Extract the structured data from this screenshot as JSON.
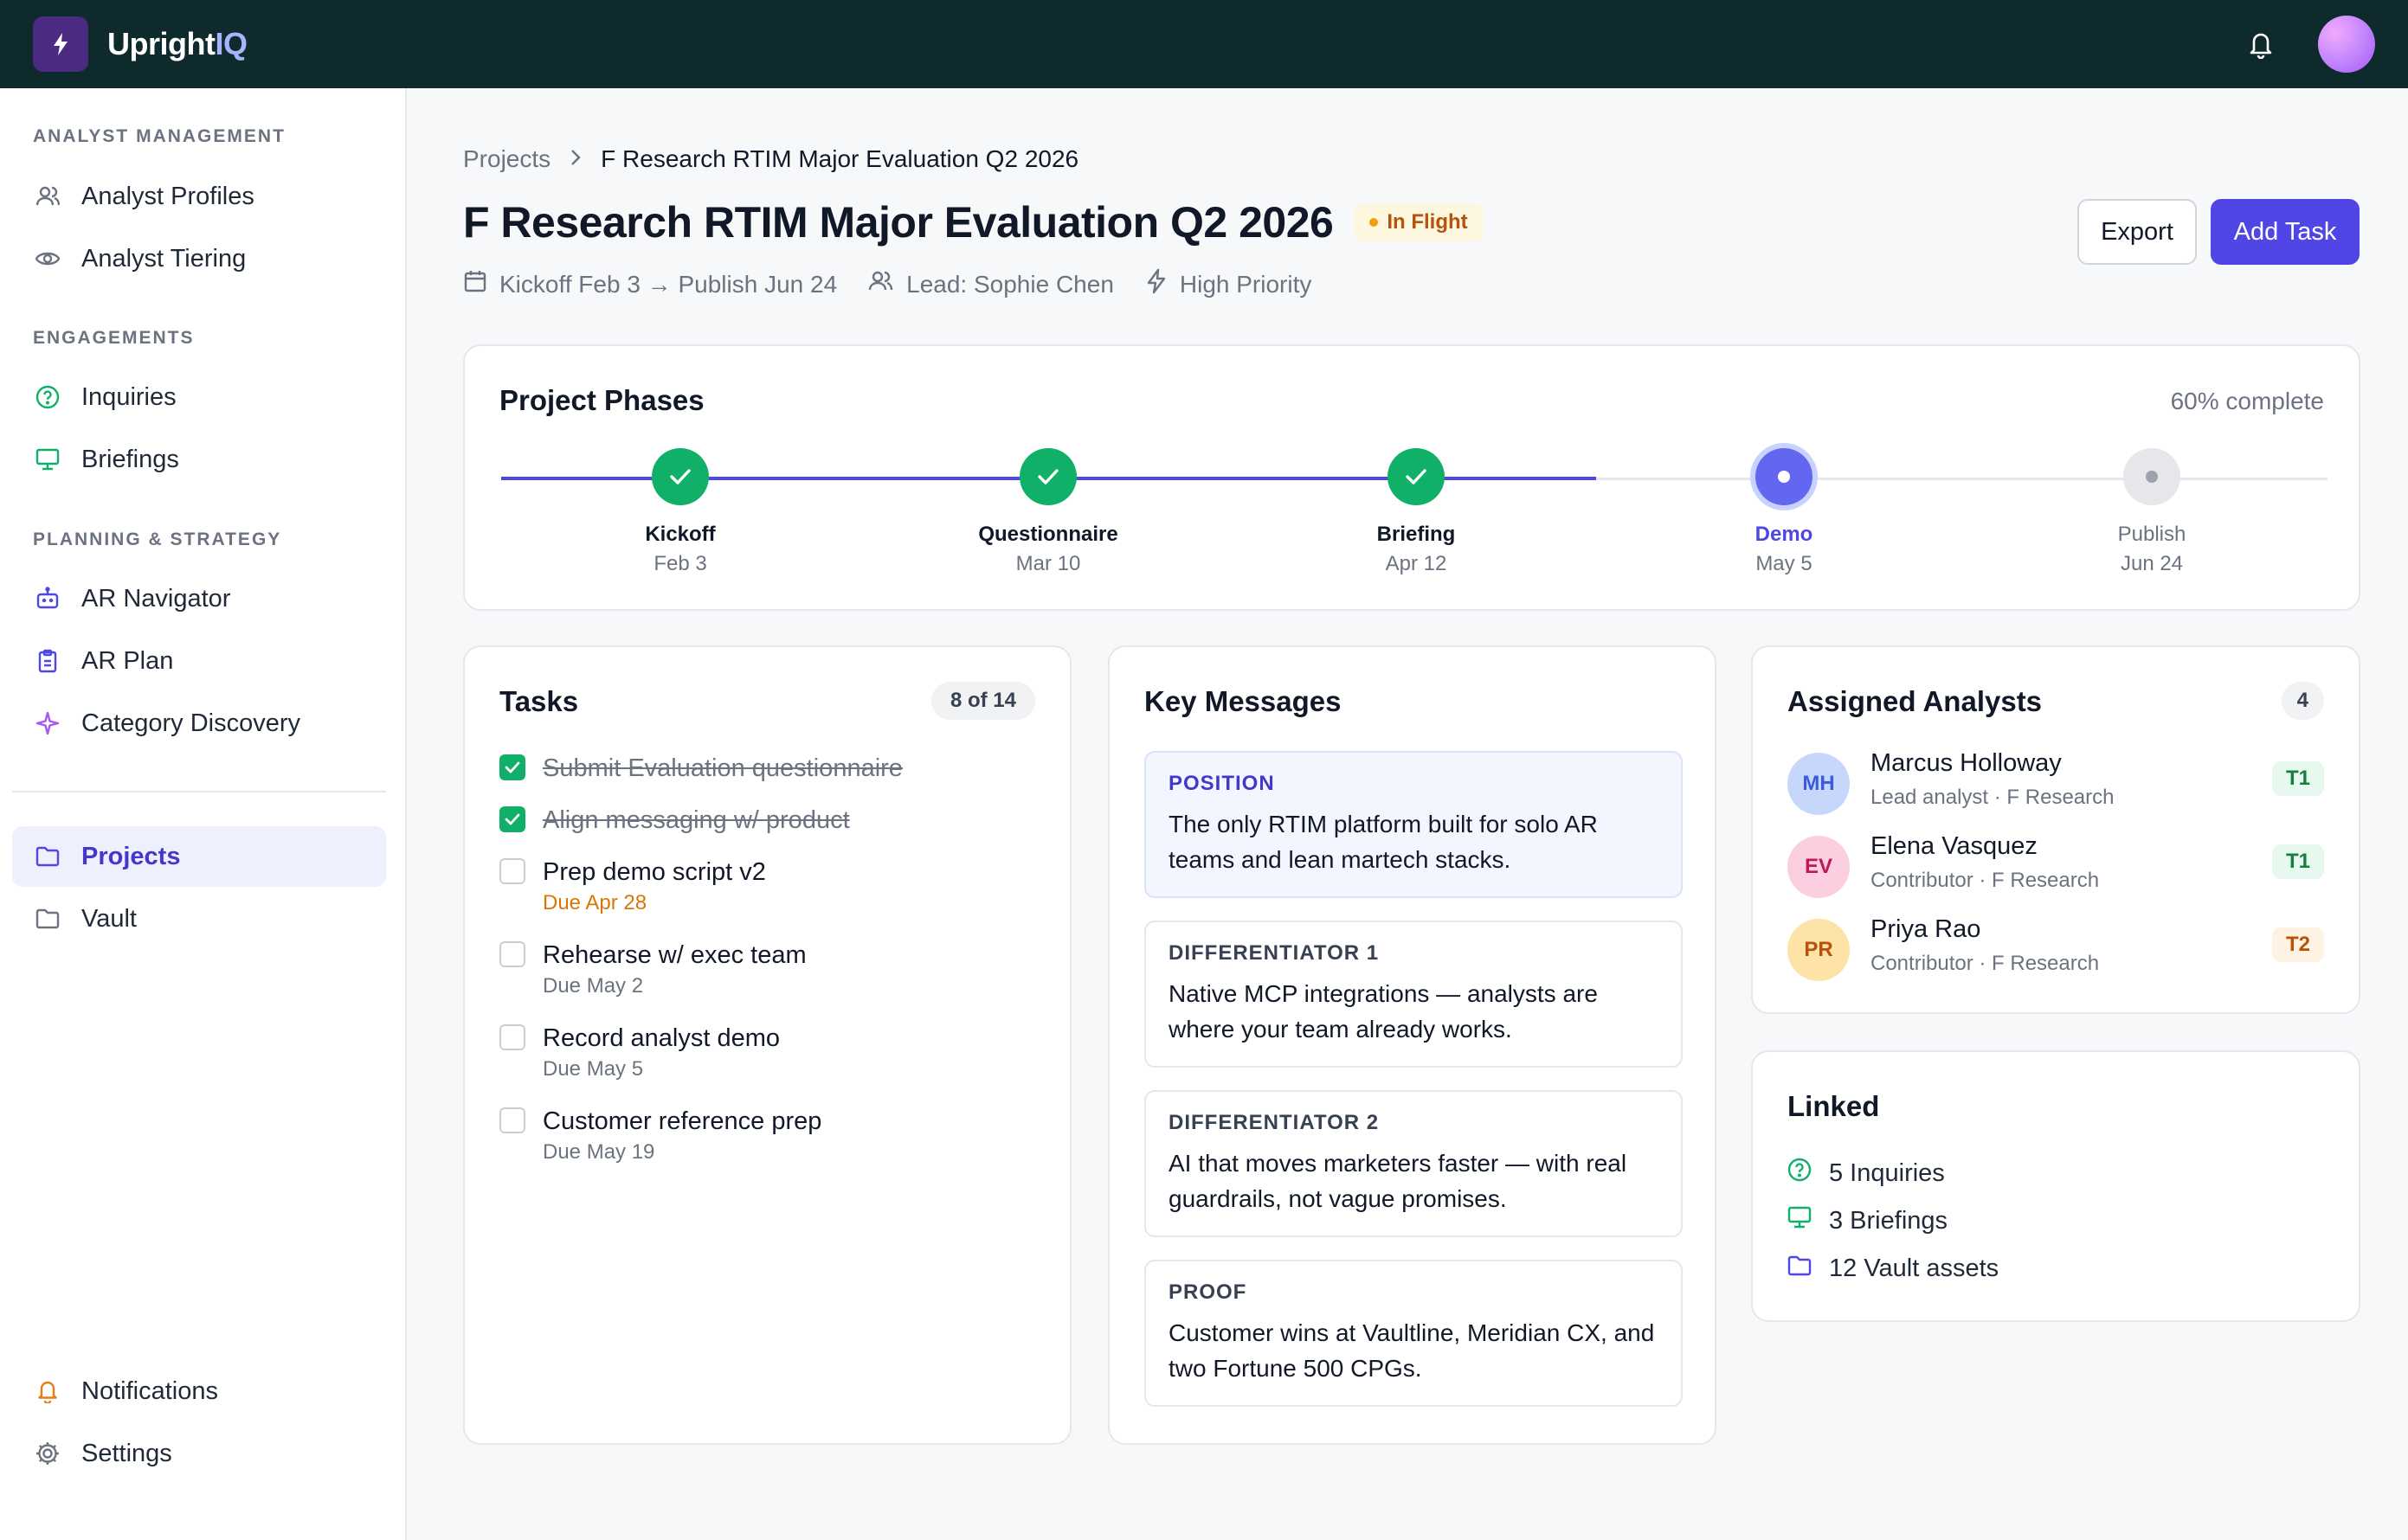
{
  "app": {
    "brand_main": "Upright",
    "brand_accent": "IQ",
    "logo_icon": "bolt-icon"
  },
  "header": {
    "notification_icon": "bell-icon",
    "avatar": "user-avatar"
  },
  "sidebar": {
    "sections": [
      {
        "title": "ANALYST MANAGEMENT"
      },
      {
        "title": "ENGAGEMENTS"
      },
      {
        "title": "PLANNING & STRATEGY"
      }
    ],
    "items": [
      {
        "label": "Analyst Profiles",
        "icon": "users-icon"
      },
      {
        "label": "Analyst Tiering",
        "icon": "eye-icon"
      },
      {
        "label": "Inquiries",
        "icon": "question-circle-icon"
      },
      {
        "label": "Briefings",
        "icon": "monitor-icon"
      },
      {
        "label": "AR Navigator",
        "icon": "robot-icon"
      },
      {
        "label": "AR Plan",
        "icon": "clipboard-icon"
      },
      {
        "label": "Category Discovery",
        "icon": "sparkle-icon"
      },
      {
        "label": "Projects",
        "icon": "folder-icon",
        "active": true
      },
      {
        "label": "Vault",
        "icon": "folder-icon"
      },
      {
        "label": "Notifications",
        "icon": "bell-icon"
      },
      {
        "label": "Settings",
        "icon": "gear-icon"
      }
    ]
  },
  "breadcrumb": {
    "parent": "Projects",
    "current": "F Research RTIM Major Evaluation Q2 2026"
  },
  "project": {
    "title": "F Research RTIM Major Evaluation Q2 2026",
    "status": "In Flight",
    "dates": "Kickoff Feb 3 → Publish Jun 24",
    "lead": "Lead: Sophie Chen",
    "priority": "High Priority"
  },
  "actions": {
    "export": "Export",
    "add_task": "Add Task"
  },
  "phases": {
    "title": "Project Phases",
    "complete": "60% complete",
    "progress_fraction": 0.6,
    "items": [
      {
        "label": "Kickoff",
        "date": "Feb 3",
        "state": "done"
      },
      {
        "label": "Questionnaire",
        "date": "Mar 10",
        "state": "done"
      },
      {
        "label": "Briefing",
        "date": "Apr 12",
        "state": "done"
      },
      {
        "label": "Demo",
        "date": "May 5",
        "state": "current"
      },
      {
        "label": "Publish",
        "date": "Jun 24",
        "state": "pending"
      }
    ]
  },
  "tasks": {
    "title": "Tasks",
    "count": "8 of 14",
    "items": [
      {
        "label": "Submit Evaluation questionnaire",
        "done": true,
        "due": ""
      },
      {
        "label": "Align messaging w/ product",
        "done": true,
        "due": ""
      },
      {
        "label": "Prep demo script v2",
        "done": false,
        "due": "Due Apr 28",
        "soon": true
      },
      {
        "label": "Rehearse w/ exec team",
        "done": false,
        "due": "Due May 2"
      },
      {
        "label": "Record analyst demo",
        "done": false,
        "due": "Due May 5"
      },
      {
        "label": "Customer reference prep",
        "done": false,
        "due": "Due May 19"
      }
    ]
  },
  "key_messages": {
    "title": "Key Messages",
    "items": [
      {
        "label": "POSITION",
        "body": "The only RTIM platform built for solo AR teams and lean martech stacks."
      },
      {
        "label": "DIFFERENTIATOR 1",
        "body": "Native MCP integrations — analysts are where your team already works."
      },
      {
        "label": "DIFFERENTIATOR 2",
        "body": "AI that moves marketers faster — with real guardrails, not vague promises."
      },
      {
        "label": "PROOF",
        "body": "Customer wins at Vaultline, Meridian CX, and two Fortune 500 CPGs."
      }
    ]
  },
  "analysts": {
    "title": "Assigned Analysts",
    "count": "4",
    "items": [
      {
        "initials": "MH",
        "name": "Marcus Holloway",
        "role": "Lead analyst · F Research",
        "tier": "T1",
        "avatar_bg": "#c7d7fb",
        "avatar_fg": "#3b5bdb"
      },
      {
        "initials": "EV",
        "name": "Elena Vasquez",
        "role": "Contributor · F Research",
        "tier": "T1",
        "avatar_bg": "#fbcfe0",
        "avatar_fg": "#be185d"
      },
      {
        "initials": "PR",
        "name": "Priya Rao",
        "role": "Contributor · F Research",
        "tier": "T2",
        "avatar_bg": "#fde3a7",
        "avatar_fg": "#b45309"
      }
    ]
  },
  "linked": {
    "title": "Linked",
    "items": [
      {
        "label": "5 Inquiries",
        "icon": "question-circle-icon"
      },
      {
        "label": "3 Briefings",
        "icon": "monitor-icon"
      },
      {
        "label": "12 Vault assets",
        "icon": "folder-icon"
      }
    ]
  },
  "colors": {
    "accent": "#4f46e5",
    "topbar": "#0f2a2c",
    "success": "#10b068",
    "warning": "#d97706"
  }
}
